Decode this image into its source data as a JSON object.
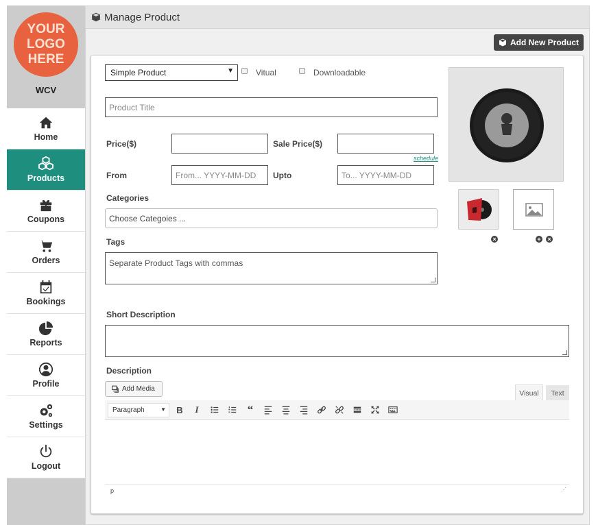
{
  "sidebar": {
    "logo_text": "YOUR\nLOGO\nHERE",
    "store_name": "WCV",
    "items": [
      {
        "label": "Home",
        "icon": "home-icon"
      },
      {
        "label": "Products",
        "icon": "cubes-icon",
        "active": true
      },
      {
        "label": "Coupons",
        "icon": "gift-icon"
      },
      {
        "label": "Orders",
        "icon": "cart-icon"
      },
      {
        "label": "Bookings",
        "icon": "calendar-check-icon"
      },
      {
        "label": "Reports",
        "icon": "pie-chart-icon"
      },
      {
        "label": "Profile",
        "icon": "user-circle-icon"
      },
      {
        "label": "Settings",
        "icon": "gears-icon"
      },
      {
        "label": "Logout",
        "icon": "power-icon"
      }
    ],
    "active_color": "#1e8e7e"
  },
  "header": {
    "title": "Manage Product",
    "add_button_label": "Add New Product"
  },
  "form": {
    "product_type": "Simple Product",
    "virtual_label": "Vitual",
    "downloadable_label": "Downloadable",
    "title_placeholder": "Product Title",
    "price_label": "Price($)",
    "sale_price_label": "Sale Price($)",
    "schedule_link": "schedule",
    "from_label": "From",
    "from_placeholder": "From... YYYY-MM-DD",
    "upto_label": "Upto",
    "upto_placeholder": "To... YYYY-MM-DD",
    "categories_label": "Categories",
    "categories_placeholder": "Choose Categoies ...",
    "tags_label": "Tags",
    "tags_placeholder": "Separate Product Tags with commas",
    "short_description_label": "Short Description",
    "description_label": "Description"
  },
  "editor": {
    "add_media_label": "Add Media",
    "tab_visual": "Visual",
    "tab_text": "Text",
    "format_select": "Paragraph",
    "toolbar_icons": [
      "bold-icon",
      "italic-icon",
      "bullet-list-icon",
      "numbered-list-icon",
      "blockquote-icon",
      "align-left-icon",
      "align-center-icon",
      "align-right-icon",
      "link-icon",
      "unlink-icon",
      "read-more-icon",
      "fullscreen-icon",
      "toolbar-toggle-icon"
    ],
    "status_path": "p"
  },
  "gallery": {
    "remove_icon": "remove-circle-icon",
    "add_icon": "add-circle-icon"
  }
}
